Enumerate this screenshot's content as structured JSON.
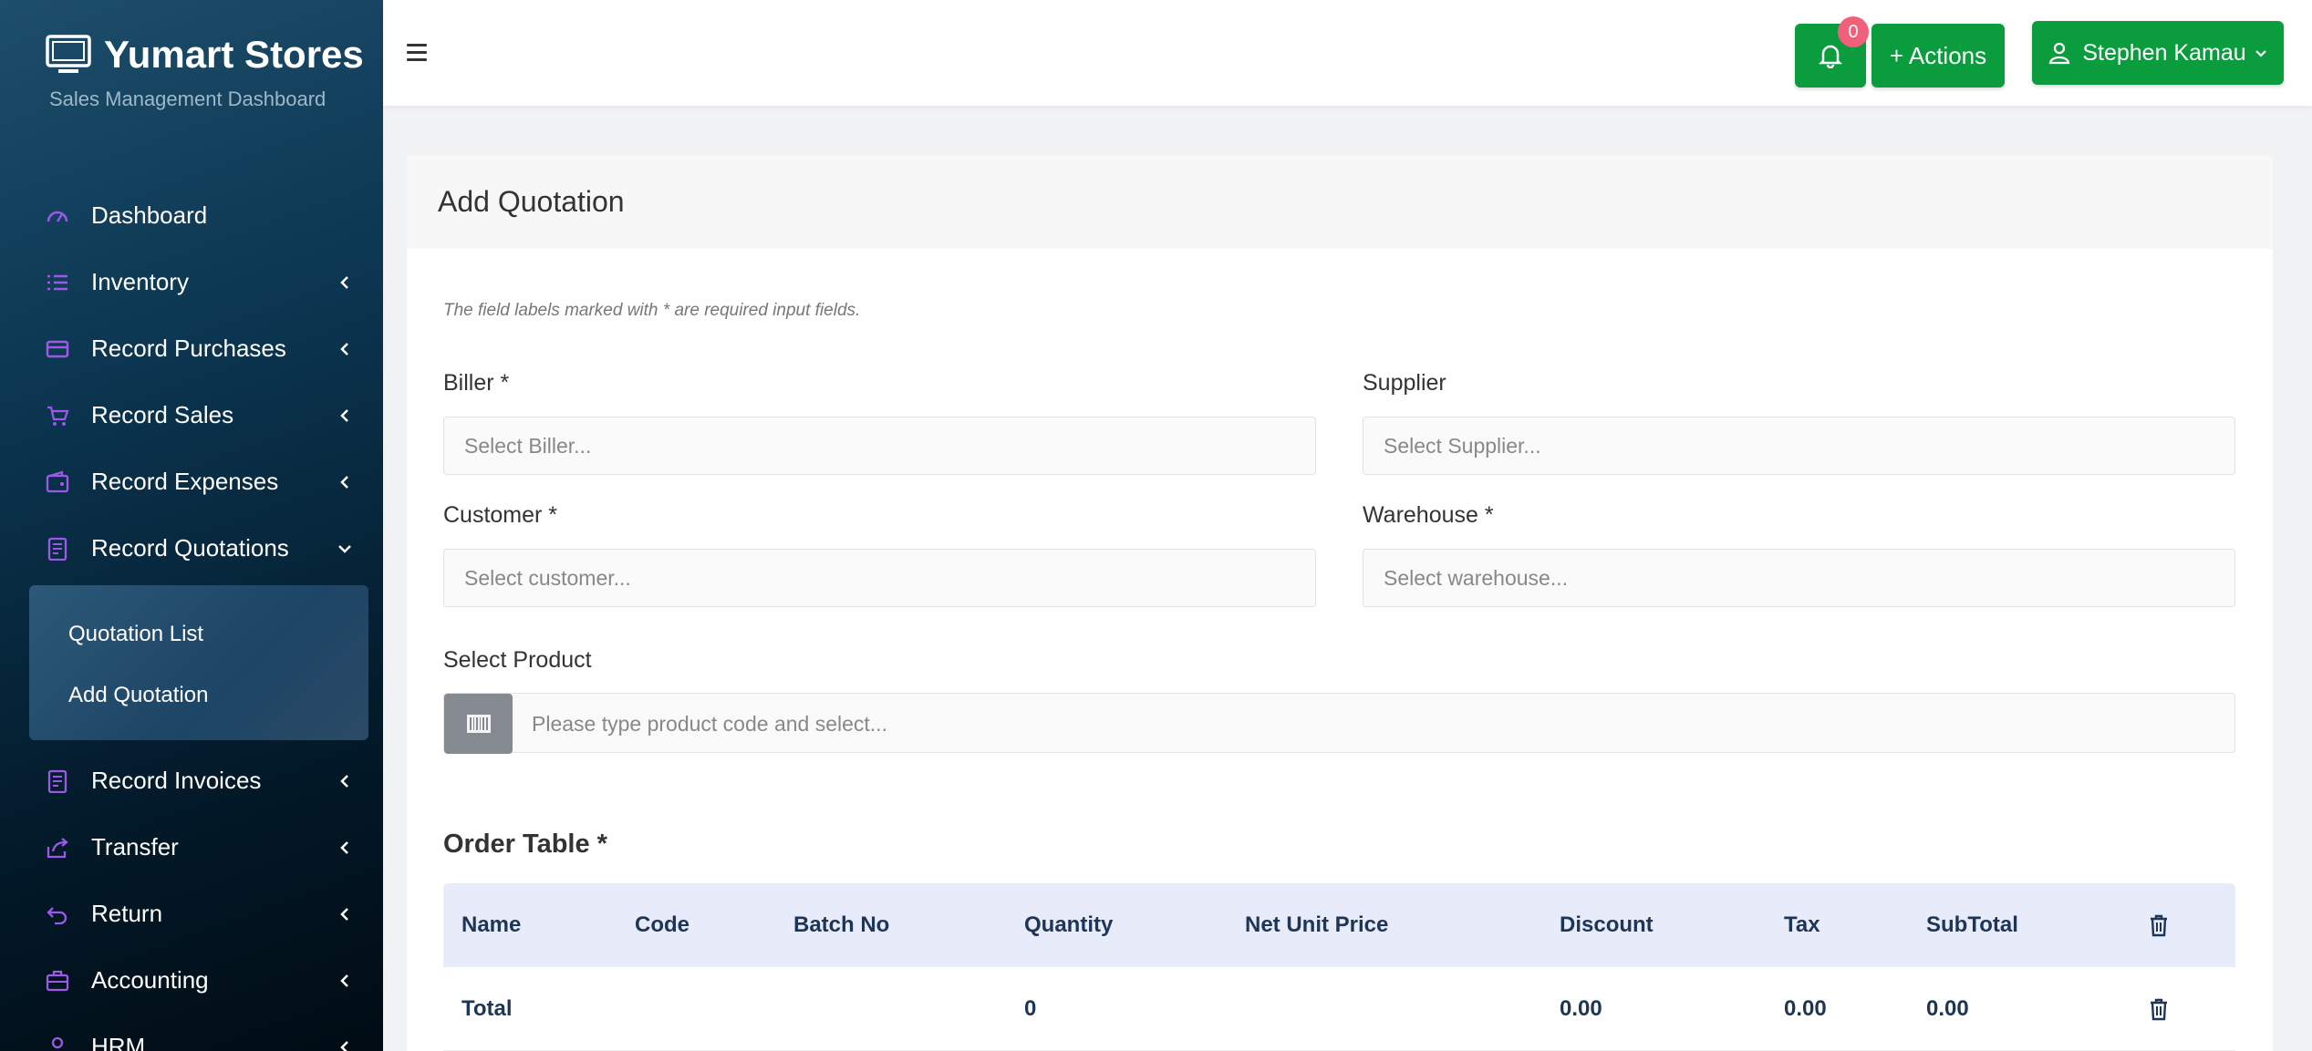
{
  "brand": {
    "title": "Yumart Stores",
    "subtitle": "Sales Management Dashboard"
  },
  "sidebar": {
    "items": [
      {
        "label": "Dashboard",
        "icon": "speedometer-icon"
      },
      {
        "label": "Inventory",
        "icon": "list-icon"
      },
      {
        "label": "Record Purchases",
        "icon": "card-icon"
      },
      {
        "label": "Record Sales",
        "icon": "cart-icon"
      },
      {
        "label": "Record Expenses",
        "icon": "wallet-icon"
      },
      {
        "label": "Record Quotations",
        "icon": "document-icon"
      },
      {
        "label": "Record Invoices",
        "icon": "document-icon"
      },
      {
        "label": "Transfer",
        "icon": "share-icon"
      },
      {
        "label": "Return",
        "icon": "return-icon"
      },
      {
        "label": "Accounting",
        "icon": "briefcase-icon"
      },
      {
        "label": "HRM",
        "icon": "user-icon"
      }
    ],
    "quotation_sub": [
      "Quotation List",
      "Add Quotation"
    ]
  },
  "header": {
    "notification_count": "0",
    "actions_label": "+ Actions",
    "user_name": "Stephen Kamau"
  },
  "form": {
    "title": "Add Quotation",
    "hint": "The field labels marked with * are required input fields.",
    "biller_label": "Biller *",
    "biller_placeholder": "Select Biller...",
    "supplier_label": "Supplier",
    "supplier_placeholder": "Select Supplier...",
    "customer_label": "Customer *",
    "customer_placeholder": "Select customer...",
    "warehouse_label": "Warehouse *",
    "warehouse_placeholder": "Select warehouse...",
    "product_label": "Select Product",
    "product_placeholder": "Please type product code and select..."
  },
  "order_table": {
    "title": "Order Table *",
    "columns": [
      "Name",
      "Code",
      "Batch No",
      "Quantity",
      "Net Unit Price",
      "Discount",
      "Tax",
      "SubTotal"
    ],
    "total_row": {
      "label": "Total",
      "quantity": "0",
      "discount": "0.00",
      "tax": "0.00",
      "subtotal": "0.00"
    }
  },
  "colors": {
    "accent_green": "#0b9c3d",
    "badge_pink": "#f0607a",
    "icon_purple": "#9b59e6"
  }
}
